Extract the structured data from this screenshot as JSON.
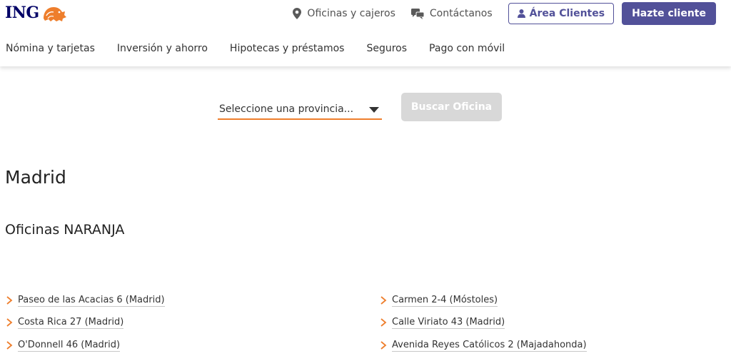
{
  "header": {
    "logo_text": "ING",
    "util_links": {
      "offices": "Oficinas y cajeros",
      "contact": "Contáctanos"
    },
    "area_clientes": "Área Clientes",
    "hazte_cliente": "Hazte cliente"
  },
  "nav": {
    "items": [
      "Nómina y tarjetas",
      "Inversión y ahorro",
      "Hipotecas y préstamos",
      "Seguros",
      "Pago con móvil"
    ]
  },
  "search": {
    "province_selected": "Seleccione una provincia...",
    "button": "Buscar Oficina"
  },
  "main": {
    "city": "Madrid",
    "office_type": "Oficinas NARANJA",
    "offices_left": [
      "Paseo de las Acacias 6 (Madrid)",
      "Costa Rica 27 (Madrid)",
      "O'Donnell 46 (Madrid)"
    ],
    "offices_right": [
      "Carmen 2-4 (Móstoles)",
      "Calle Viriato 43 (Madrid)",
      "Avenida Reyes Católicos 2 (Majadahonda)"
    ]
  },
  "colors": {
    "brand_navy": "#000066",
    "brand_orange": "#ee7e2c",
    "accent_purple": "#525199",
    "disabled_gray": "#d8d8d8"
  },
  "icons": {
    "logo": "lion-icon",
    "offices": "map-pin-icon",
    "contact": "chat-bubbles-icon",
    "area_clientes": "user-icon",
    "province": "caret-down-icon",
    "office_item": "chevron-right-icon"
  }
}
